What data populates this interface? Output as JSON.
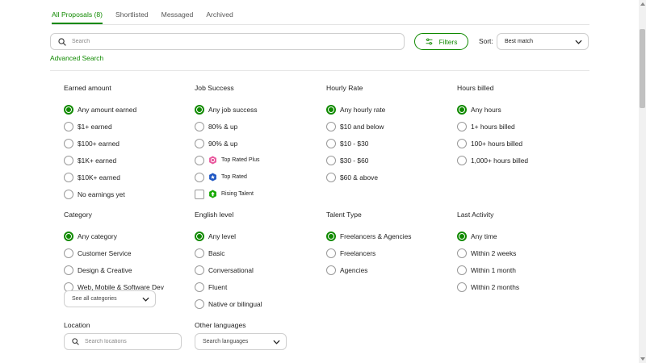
{
  "tabs": [
    {
      "label": "All Proposals (8)",
      "active": true
    },
    {
      "label": "Shortlisted",
      "active": false
    },
    {
      "label": "Messaged",
      "active": false
    },
    {
      "label": "Archived",
      "active": false
    }
  ],
  "search": {
    "placeholder": "Search",
    "value": ""
  },
  "filters_label": "Filters",
  "sort": {
    "label": "Sort:",
    "value": "Best match"
  },
  "advanced_search": "Advanced Search",
  "earned": {
    "title": "Earned amount",
    "options": [
      "Any amount earned",
      "$1+ earned",
      "$100+ earned",
      "$1K+ earned",
      "$10K+ earned",
      "No earnings yet"
    ],
    "selected": 0
  },
  "job_success": {
    "title": "Job Success",
    "options": [
      "Any job success",
      "80% & up",
      "90% & up"
    ],
    "badges": [
      "Top Rated Plus",
      "Top Rated"
    ],
    "rising": "Rising Talent",
    "selected": 0
  },
  "hourly": {
    "title": "Hourly Rate",
    "options": [
      "Any hourly rate",
      "$10 and below",
      "$10 - $30",
      "$30 - $60",
      "$60 & above"
    ],
    "selected": 0
  },
  "hours": {
    "title": "Hours billed",
    "options": [
      "Any hours",
      "1+ hours billed",
      "100+ hours billed",
      "1,000+ hours billed"
    ],
    "selected": 0
  },
  "category": {
    "title": "Category",
    "options": [
      "Any category",
      "Customer Service",
      "Design & Creative",
      "Web, Mobile & Software Dev"
    ],
    "selected": 0,
    "see_all": "See all categories"
  },
  "english": {
    "title": "English level",
    "options": [
      "Any level",
      "Basic",
      "Conversational",
      "Fluent",
      "Native or bilingual"
    ],
    "selected": 0
  },
  "talent": {
    "title": "Talent Type",
    "options": [
      "Freelancers & Agencies",
      "Freelancers",
      "Agencies"
    ],
    "selected": 0
  },
  "activity": {
    "title": "Last Activity",
    "options": [
      "Any time",
      "Within 2 weeks",
      "Within 1 month",
      "Within 2 months"
    ],
    "selected": 0
  },
  "location": {
    "title": "Location",
    "placeholder": "Search locations"
  },
  "languages": {
    "title": "Other languages",
    "placeholder": "Search languages"
  },
  "colors": {
    "accent": "#108a00",
    "top_rated_plus": "#e9579d",
    "top_rated": "#1f57c3",
    "rising_talent": "#14a800"
  },
  "icons": [
    "search-icon",
    "filters-icon",
    "chevron-down-icon",
    "top-rated-plus-icon",
    "top-rated-icon",
    "rising-talent-icon"
  ]
}
